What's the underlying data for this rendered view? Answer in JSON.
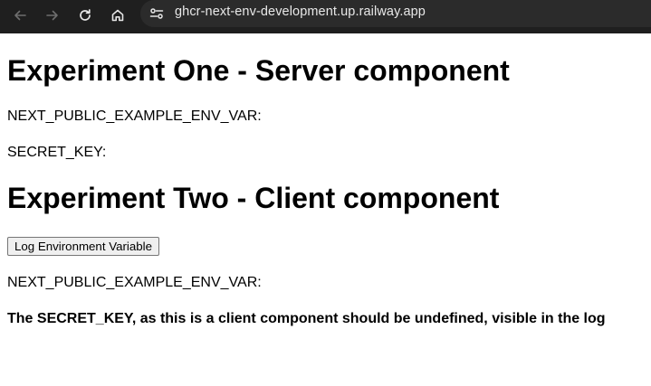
{
  "browser": {
    "url": "ghcr-next-env-development.up.railway.app"
  },
  "main": {
    "experiment_one": {
      "heading": "Experiment One - Server component",
      "public_env_label": "NEXT_PUBLIC_EXAMPLE_ENV_VAR:",
      "secret_key_label": "SECRET_KEY:"
    },
    "experiment_two": {
      "heading": "Experiment Two - Client component",
      "button_label": "Log Environment Variable",
      "public_env_label": "NEXT_PUBLIC_EXAMPLE_ENV_VAR:",
      "note": "The SECRET_KEY, as this is a client component should be undefined, visible in the log"
    }
  }
}
